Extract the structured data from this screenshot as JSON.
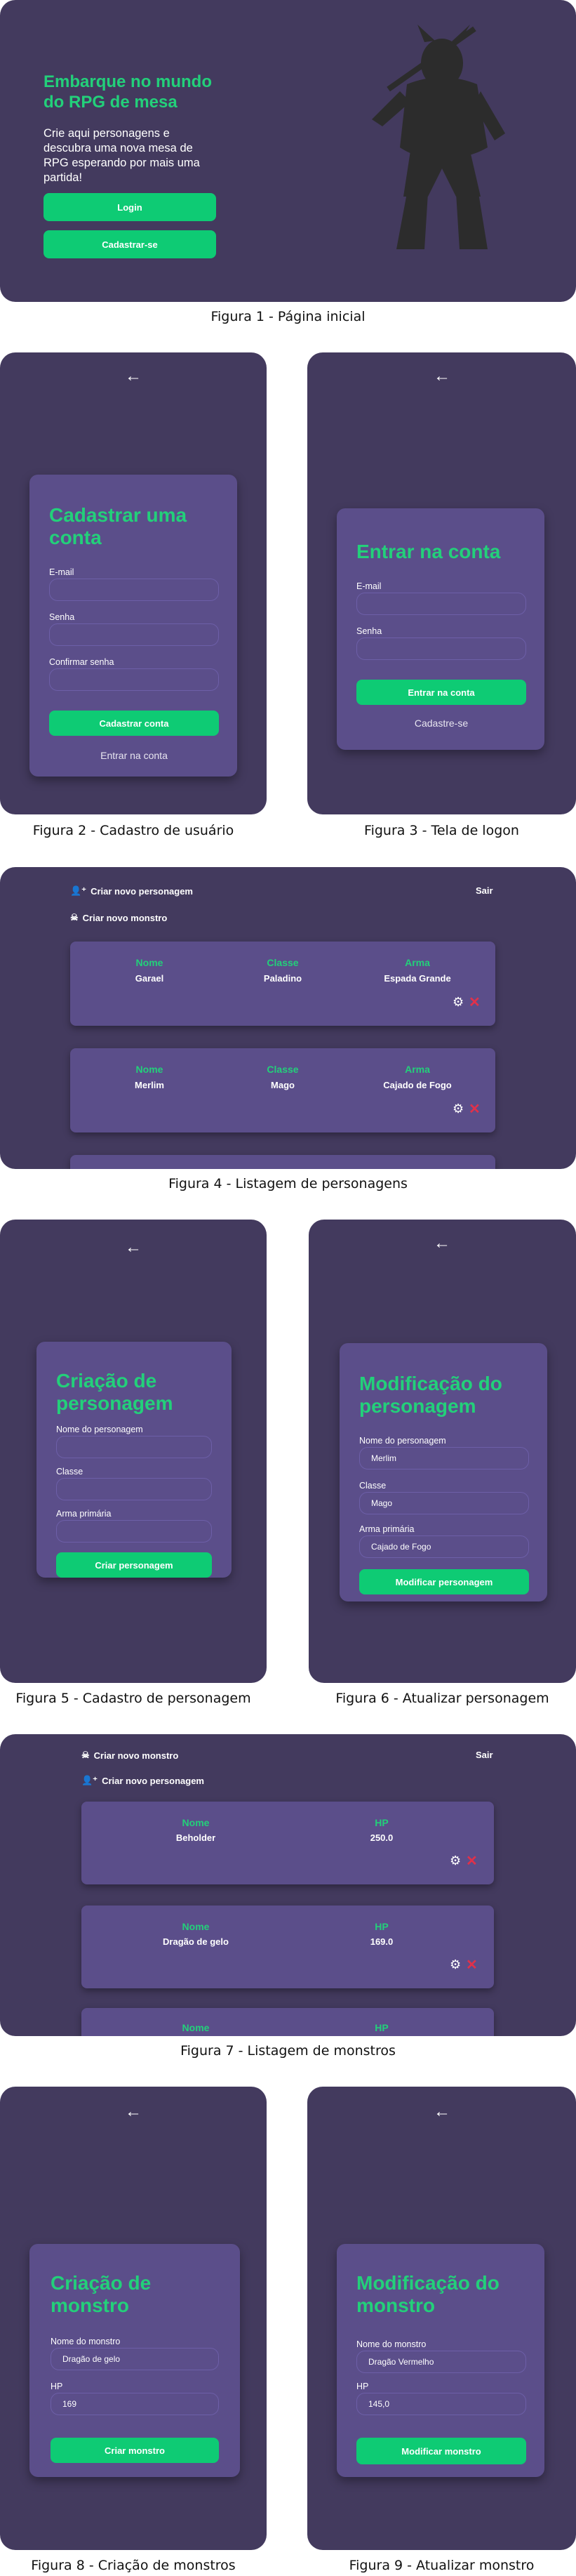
{
  "fig1": {
    "headline": "Embarque no mundo do RPG de mesa",
    "text": "Crie aqui personagens e descubra uma nova mesa de RPG esperando por mais uma partida!",
    "login": "Login",
    "register": "Cadastrar-se",
    "caption": "Figura 1 - Página inicial"
  },
  "fig2": {
    "title": "Cadastrar uma conta",
    "email": "E-mail",
    "password": "Senha",
    "confirm": "Confirmar senha",
    "submit": "Cadastrar conta",
    "link": "Entrar na conta",
    "caption": "Figura 2 - Cadastro de usuário"
  },
  "fig3": {
    "title": "Entrar na conta",
    "email": "E-mail",
    "password": "Senha",
    "submit": "Entrar na conta",
    "link": "Cadastre-se",
    "caption": "Figura 3 - Tela de logon"
  },
  "fig4": {
    "nav_create_char": "Criar novo personagem",
    "nav_create_monster": "Criar novo monstro",
    "logout": "Sair",
    "headers": [
      "Nome",
      "Classe",
      "Arma"
    ],
    "rows": [
      [
        "Garael",
        "Paladino",
        "Espada Grande"
      ],
      [
        "Merlim",
        "Mago",
        "Cajado de Fogo"
      ]
    ],
    "caption": "Figura 4 - Listagem de personagens"
  },
  "fig5": {
    "title": "Criação de personagem",
    "name": "Nome do personagem",
    "class": "Classe",
    "weapon": "Arma primária",
    "submit": "Criar personagem",
    "caption": "Figura 5 - Cadastro de personagem"
  },
  "fig6": {
    "title": "Modificação do personagem",
    "name": "Nome do personagem",
    "name_value": "Merlim",
    "class": "Classe",
    "class_value": "Mago",
    "weapon": "Arma primária",
    "weapon_value": "Cajado de Fogo",
    "submit": "Modificar personagem",
    "caption": "Figura 6 - Atualizar personagem"
  },
  "fig7": {
    "nav_create_monster": "Criar novo monstro",
    "nav_create_char": "Criar novo personagem",
    "logout": "Sair",
    "headers": [
      "Nome",
      "HP"
    ],
    "rows": [
      [
        "Beholder",
        "250.0"
      ],
      [
        "Dragão de gelo",
        "169.0"
      ]
    ],
    "caption": "Figura 7 - Listagem de monstros"
  },
  "fig8": {
    "title": "Criação de monstro",
    "name": "Nome do monstro",
    "name_value": "Dragão de gelo",
    "hp": "HP",
    "hp_value": "169",
    "submit": "Criar monstro",
    "caption": "Figura 8 - Criação de monstros"
  },
  "fig9": {
    "title": "Modificação do monstro",
    "name": "Nome do monstro",
    "name_value": "Dragão Vermelho",
    "hp": "HP",
    "hp_value": "145,0",
    "submit": "Modificar monstro",
    "caption": "Figura 9 - Atualizar monstro"
  },
  "colors": {
    "bg": "#433a5e",
    "card": "#5b4e8a",
    "accent": "#23d07a",
    "button": "#0ecb74",
    "danger": "#e0314a"
  },
  "icons": [
    "arrow-left-icon",
    "user-plus-icon",
    "skull-icon",
    "gear-icon",
    "close-icon",
    "warrior-silhouette-icon"
  ]
}
